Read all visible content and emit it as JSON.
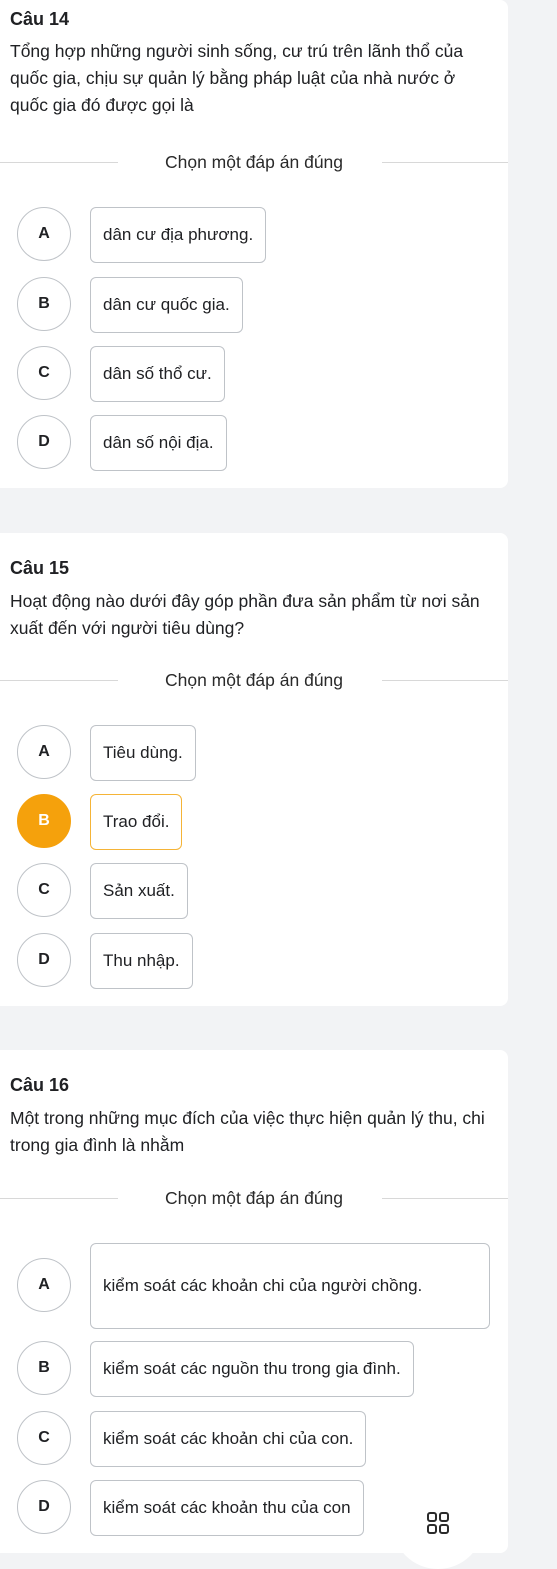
{
  "questions": [
    {
      "title": "Câu 14",
      "text": "Tổng hợp những người sinh sống, cư trú trên lãnh thổ của quốc gia, chịu sự quản lý bằng pháp luật của nhà nước ở quốc gia đó được gọi là",
      "instruction": "Chọn một đáp án đúng",
      "options": [
        {
          "letter": "A",
          "text": "dân cư địa phương."
        },
        {
          "letter": "B",
          "text": "dân cư quốc gia."
        },
        {
          "letter": "C",
          "text": "dân số thổ cư."
        },
        {
          "letter": "D",
          "text": "dân số nội địa."
        }
      ]
    },
    {
      "title": "Câu 15",
      "text": "Hoạt động nào dưới đây góp phần đưa sản phẩm từ nơi sản xuất đến với người tiêu dùng?",
      "instruction": "Chọn một đáp án đúng",
      "selected": "B",
      "options": [
        {
          "letter": "A",
          "text": "Tiêu dùng."
        },
        {
          "letter": "B",
          "text": "Trao đổi."
        },
        {
          "letter": "C",
          "text": "Sản xuất."
        },
        {
          "letter": "D",
          "text": "Thu nhập."
        }
      ]
    },
    {
      "title": "Câu 16",
      "text": "Một trong những mục đích của việc thực hiện quản lý thu, chi trong gia đình là nhằm",
      "instruction": "Chọn một đáp án đúng",
      "options": [
        {
          "letter": "A",
          "text": "kiểm soát các khoản chi của người chồng."
        },
        {
          "letter": "B",
          "text": "kiểm soát các nguồn thu trong gia đình."
        },
        {
          "letter": "C",
          "text": "kiểm soát các khoản chi của con."
        },
        {
          "letter": "D",
          "text": "kiểm soát các khoản thu của con"
        }
      ]
    }
  ],
  "colors": {
    "selected_accent": "#f5a10c",
    "page_background": "#f2f3f5",
    "card_background": "#ffffff"
  },
  "floating_button_icon": "grid-menu-icon"
}
